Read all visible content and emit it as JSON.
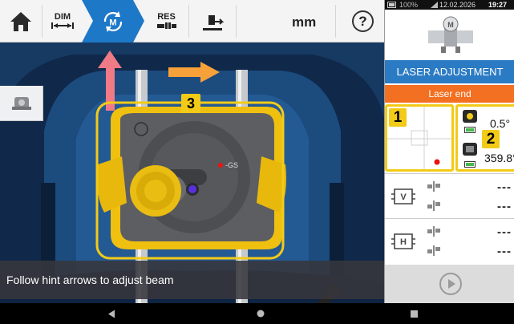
{
  "toolbar": {
    "home_icon": "home-icon",
    "dim_label": "DIM",
    "measure_icon": "measure-m-icon",
    "res_label": "RES",
    "move_icon": "machine-move-icon",
    "units": "mm",
    "help_label": "?"
  },
  "camera": {
    "marker_label": "3",
    "hint": "Follow hint arrows to adjust beam",
    "laser_mark": "-GS"
  },
  "sidebar": {
    "tool_icon": "laser-tool-icon"
  },
  "status_bar": {
    "battery": "100%",
    "date": "12.02.2026",
    "time": "19:27"
  },
  "panel": {
    "title": "LASER ADJUSTMENT",
    "laser_status": "Laser end",
    "target_label": "1",
    "sensor_label": "2",
    "angle_1": "0.5°",
    "angle_2": "359.8°",
    "results": [
      {
        "icon": "vertical-icon",
        "letter": "V",
        "value_1": "---",
        "value_2": "---"
      },
      {
        "icon": "horizontal-icon",
        "letter": "H",
        "value_1": "---",
        "value_2": "---"
      }
    ]
  },
  "colors": {
    "accent": "#1d78c8",
    "highlight": "#f2cb18",
    "status": "#f36f21",
    "arrow_orange": "#f7a13b",
    "arrow_pink": "#f07a86"
  }
}
